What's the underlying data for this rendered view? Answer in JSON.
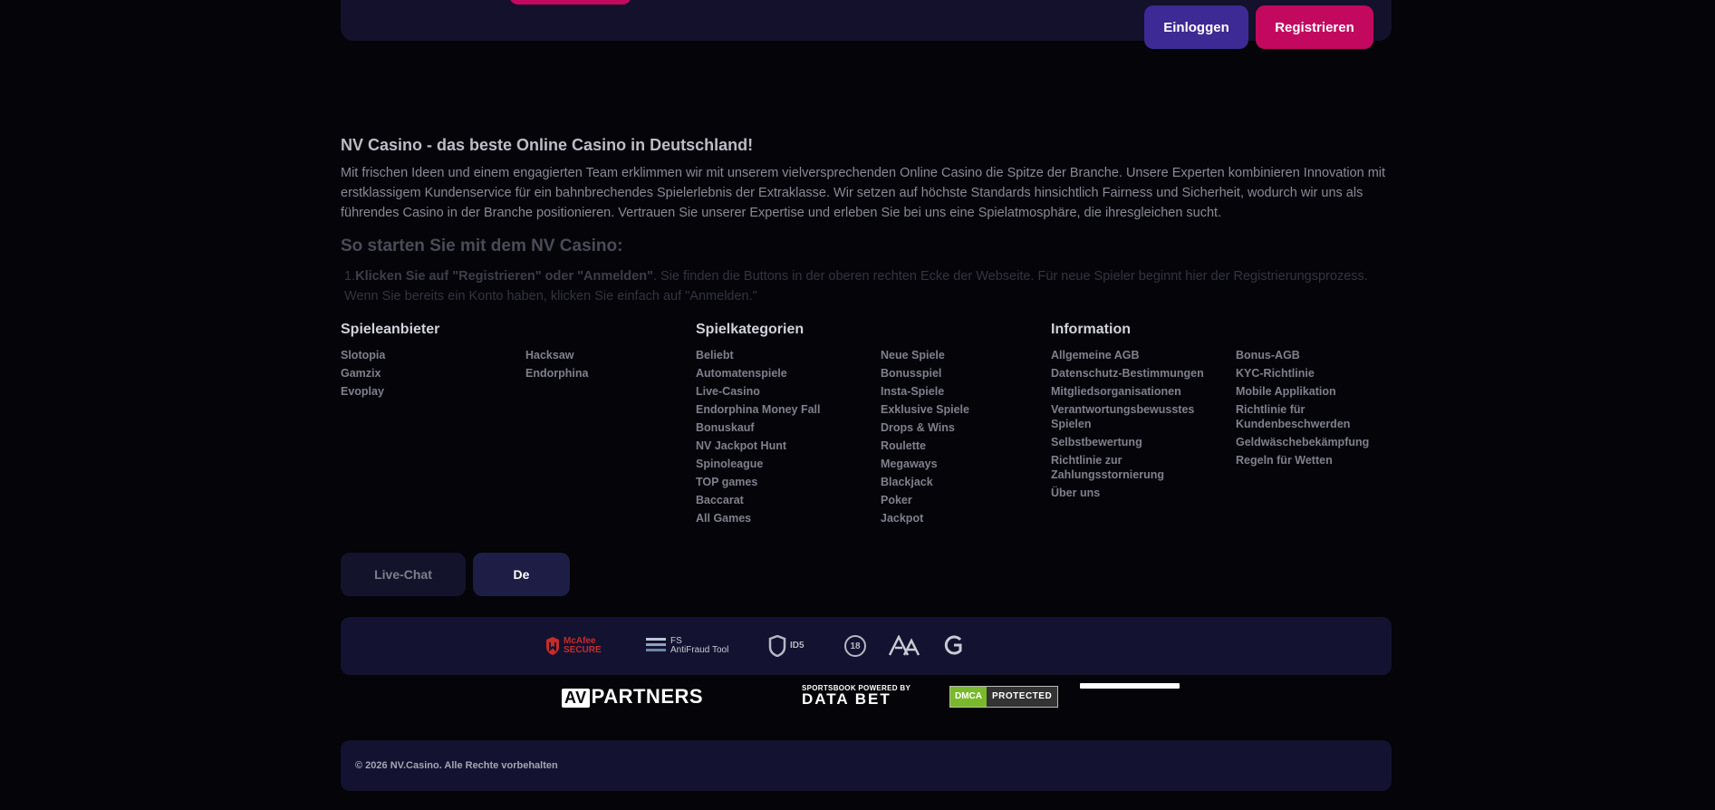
{
  "header": {
    "login_label": "Einloggen",
    "register_label": "Registrieren"
  },
  "seo": {
    "title": "NV Casino - das beste Online Casino in Deutschland!",
    "paragraph": "Mit frischen Ideen und einem engagierten Team erklimmen wir mit unserem vielversprechenden Online Casino die Spitze der Branche. Unsere Experten kombinieren Innovation mit erstklassigem Kundenservice für ein bahnbrechendes Spielerlebnis der Extraklasse. Wir setzen auf höchste Standards hinsichtlich Fairness und Sicherheit, wodurch wir uns als führendes Casino in der Branche positionieren. Vertrauen Sie unserer Expertise und erleben Sie bei uns eine Spielatmosphäre, die ihresgleichen sucht.",
    "subtitle": "So starten Sie mit dem NV Casino:",
    "step_number": "1.",
    "step_bold": "Klicken Sie auf \"Registrieren\" oder \"Anmelden\"",
    "step_text": ". Sie finden die Buttons in der oberen rechten Ecke der Webseite. Für neue Spieler beginnt hier der Registrierungsprozess. Wenn Sie bereits ein Konto haben, klicken Sie einfach auf \"Anmelden.\""
  },
  "footer_nav": {
    "providers": {
      "title": "Spieleanbieter",
      "col1": [
        "Slotopia",
        "Gamzix",
        "Evoplay"
      ],
      "col2": [
        "Hacksaw",
        "Endorphina"
      ]
    },
    "categories": {
      "title": "Spielkategorien",
      "col1": [
        "Beliebt",
        "Automatenspiele",
        "Live-Casino",
        "Endorphina Money Fall",
        "Bonuskauf",
        "NV Jackpot Hunt",
        "Spinoleague",
        "TOP games",
        "Baccarat",
        "All Games"
      ],
      "col2": [
        "Neue Spiele",
        "Bonusspiel",
        "Insta-Spiele",
        "Exklusive Spiele",
        "Drops & Wins",
        "Roulette",
        "Megaways",
        "Blackjack",
        "Poker",
        "Jackpot"
      ]
    },
    "information": {
      "title": "Information",
      "col1": [
        "Allgemeine AGB",
        "Datenschutz-Bestimmungen",
        "Mitgliedsorganisationen",
        "Verantwortungsbewusstes Spielen",
        "Selbstbewertung",
        "Richtlinie zur Zahlungsstornierung",
        "Über uns"
      ],
      "col2": [
        "Bonus-AGB",
        "KYC-Richtlinie",
        "Mobile Applikation",
        "Richtlinie für Kundenbeschwerden",
        "Geldwäschebekämpfung",
        "Regeln für Wetten"
      ]
    }
  },
  "chat_label": "Live-Chat",
  "language_label": "De",
  "certs": {
    "mcafee": [
      "McAfee",
      "SECURE"
    ],
    "fs": [
      "FS",
      "AntiFraud Tool"
    ],
    "id5": "ID5",
    "age": "18"
  },
  "partners": {
    "avp_mark": "AV",
    "avp_text": "PARTNERS",
    "databet_small": "SPORTSBOOK POWERED BY",
    "databet_big": "DATA BET",
    "dmca_left": "DMCA",
    "dmca_right": "PROTECTED"
  },
  "copyright": "© 2026  NV.Casino. Alle Rechte vorbehalten",
  "colors": {
    "background": "#040409",
    "panel": "#131230",
    "accent_purple": "#3e2a94",
    "accent_pink": "#c2095f"
  }
}
